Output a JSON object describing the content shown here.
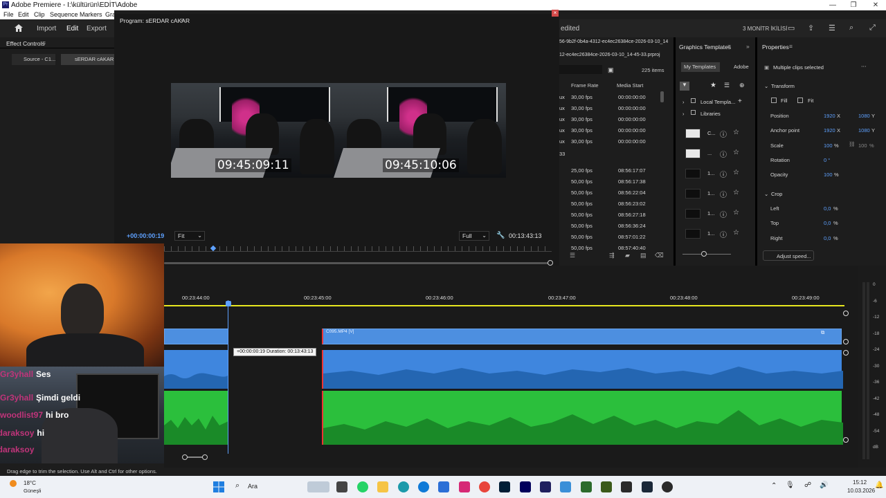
{
  "window": {
    "title": "Adobe Premiere - I:\\kültürün\\EDİT\\Adobe",
    "app_icon": "Pr"
  },
  "menu": [
    "File",
    "Edit",
    "Clip",
    "Sequence",
    "Markers",
    "Gra"
  ],
  "header": {
    "nav": [
      "Import",
      "Edit",
      "Export"
    ],
    "active": "Edit",
    "right_text": "edited",
    "workspace": "3 MONİTR İKİLİSİ"
  },
  "effect_controls": {
    "title": "Effect Controls",
    "tabs": [
      "Source - C1...",
      "sERDAR cAKAR -"
    ]
  },
  "program": {
    "title": "Program: sERDAR cAKAR",
    "timecode_left": "09:45:09:11",
    "timecode_right": "09:45:10:06",
    "playhead_tc": "+00:00:00:19",
    "fit": "Fit",
    "quality": "Full",
    "duration_tc": "00:13:43:13"
  },
  "project": {
    "path1": "56-9b2f-0b4a-4312-ec4ec26384ce-2026-03-10_14",
    "path2": "12-ec4ec26384ce-2026-03-10_14-45-33.prproj",
    "items_count": "225 items",
    "col_fps": "Frame Rate",
    "col_start": "Media Start",
    "rows": [
      {
        "pre": "ux",
        "fps": "30,00 fps",
        "start": "00:00:00:00"
      },
      {
        "pre": "ux",
        "fps": "30,00 fps",
        "start": "00:00:00:00"
      },
      {
        "pre": "ux",
        "fps": "30,00 fps",
        "start": "00:00:00:00"
      },
      {
        "pre": "ux",
        "fps": "30,00 fps",
        "start": "00:00:00:00"
      },
      {
        "pre": "ux",
        "fps": "30,00 fps",
        "start": "00:00:00:00"
      },
      {
        "pre": "33",
        "fps": "",
        "start": ""
      },
      {
        "pre": "",
        "fps": "25,00 fps",
        "start": "08:56:17:07"
      },
      {
        "pre": "",
        "fps": "50,00 fps",
        "start": "08:56:17:38"
      },
      {
        "pre": "",
        "fps": "50,00 fps",
        "start": "08:56:22:04"
      },
      {
        "pre": "",
        "fps": "50,00 fps",
        "start": "08:56:23:02"
      },
      {
        "pre": "",
        "fps": "50,00 fps",
        "start": "08:56:27:18"
      },
      {
        "pre": "",
        "fps": "50,00 fps",
        "start": "08:56:36:24"
      },
      {
        "pre": "",
        "fps": "50,00 fps",
        "start": "08:57:01:22"
      },
      {
        "pre": "",
        "fps": "50,00 fps",
        "start": "08:57:40:40"
      }
    ]
  },
  "graphics": {
    "title": "Graphics Templates",
    "tabs": [
      "My Templates",
      "Adobe"
    ],
    "local": "Local Templa...",
    "libraries": "Libraries",
    "items": [
      "C...",
      "...",
      "1...",
      "1...",
      "1...",
      "1..."
    ]
  },
  "properties": {
    "title": "Properties",
    "selection": "Multiple clips selected",
    "transform": "Transform",
    "fill": "Fill",
    "fit": "Fit",
    "position": {
      "label": "Position",
      "x": "1920",
      "y": "1080"
    },
    "anchor": {
      "label": "Anchor point",
      "x": "1920",
      "y": "1080"
    },
    "scale": {
      "label": "Scale",
      "value": "100",
      "unit": "%",
      "unit2": "%"
    },
    "rotation": {
      "label": "Rotation",
      "value": "0 °"
    },
    "opacity": {
      "label": "Opacity",
      "value": "100",
      "unit": "%"
    },
    "crop": "Crop",
    "left": {
      "label": "Left",
      "value": "0,0",
      "unit": "%"
    },
    "top": {
      "label": "Top",
      "value": "0,0",
      "unit": "%"
    },
    "right": {
      "label": "Right",
      "value": "0,0",
      "unit": "%"
    },
    "adjust": "Adjust speed...",
    "x": "X",
    "y": "Y"
  },
  "timeline": {
    "ruler": [
      "00:23:44:00",
      "00:23:45:00",
      "00:23:46:00",
      "00:23:47:00",
      "00:23:48:00",
      "00:23:49:00"
    ],
    "clip_name": "C095.MP4 [V]",
    "tooltip": "+00:00:00:19 Duration: 00:13:43:13"
  },
  "meter": [
    "0",
    "-6",
    "-12",
    "-18",
    "-24",
    "-30",
    "-36",
    "-42",
    "-48",
    "-54",
    "dB"
  ],
  "chat": [
    {
      "user": "Gr3yhall",
      "msg": "Ses"
    },
    {
      "user": "Gr3yhall",
      "msg": "Şimdi geldi"
    },
    {
      "user": "woodlist97",
      "msg": "hi bro"
    },
    {
      "user": "rdaraksoy",
      "msg": "hi"
    },
    {
      "user": "rdaraksoy",
      "msg": ""
    }
  ],
  "status": "Drag edge to trim the selection. Use Alt and Ctrl for other options.",
  "taskbar": {
    "temp": "18°C",
    "weather": "Güneşli",
    "search": "Ara",
    "time": "15:12",
    "date": "10.03.2026"
  },
  "colors": {
    "accent": "#5ea1ff",
    "video_clip": "#4d8fe0",
    "audio1": "#3f86de",
    "audio2": "#2bbf3c",
    "chat_user": "#c0347a"
  }
}
